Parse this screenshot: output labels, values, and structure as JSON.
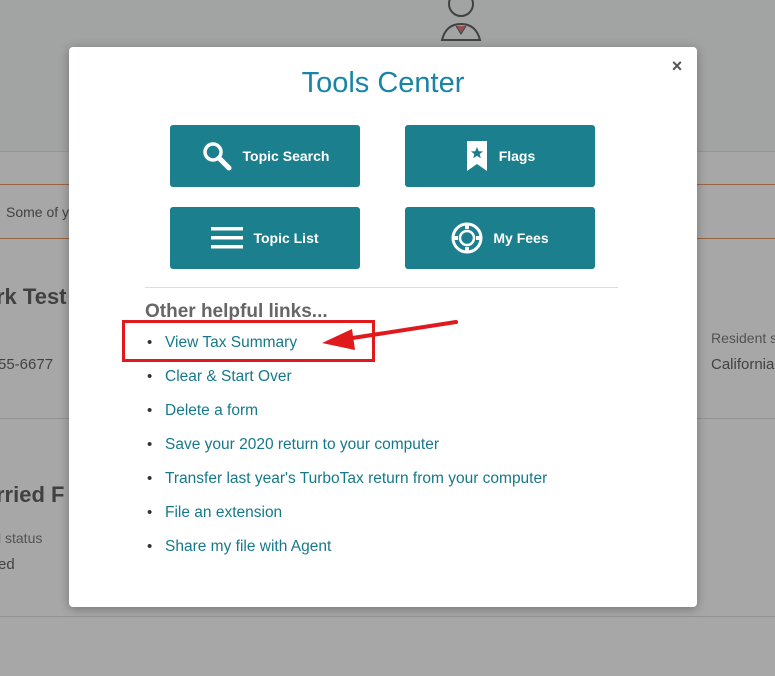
{
  "background": {
    "notice_text": "Some of y",
    "name_partial": "rk Test",
    "phone_partial": "55-6677",
    "resident_label": "Resident s",
    "resident_value": "California",
    "filing_partial": "rried F",
    "status_label": "l status",
    "status_value": "ed"
  },
  "modal": {
    "title": "Tools Center",
    "close_label": "×",
    "buttons": [
      {
        "label": "Topic Search",
        "icon": "search-icon"
      },
      {
        "label": "Flags",
        "icon": "bookmark-star-icon"
      },
      {
        "label": "Topic List",
        "icon": "menu-icon"
      },
      {
        "label": "My Fees",
        "icon": "poker-chip-icon"
      }
    ],
    "links_heading": "Other helpful links...",
    "links": [
      "View Tax Summary",
      "Clear & Start Over",
      "Delete a form",
      "Save your 2020 return to your computer",
      "Transfer last year's TurboTax return from your computer",
      "File an extension",
      "Share my file with Agent"
    ]
  },
  "colors": {
    "accent": "#1a84a6",
    "button_bg": "#1b7f8e",
    "link": "#16798a",
    "annotation": "#e0191c"
  }
}
